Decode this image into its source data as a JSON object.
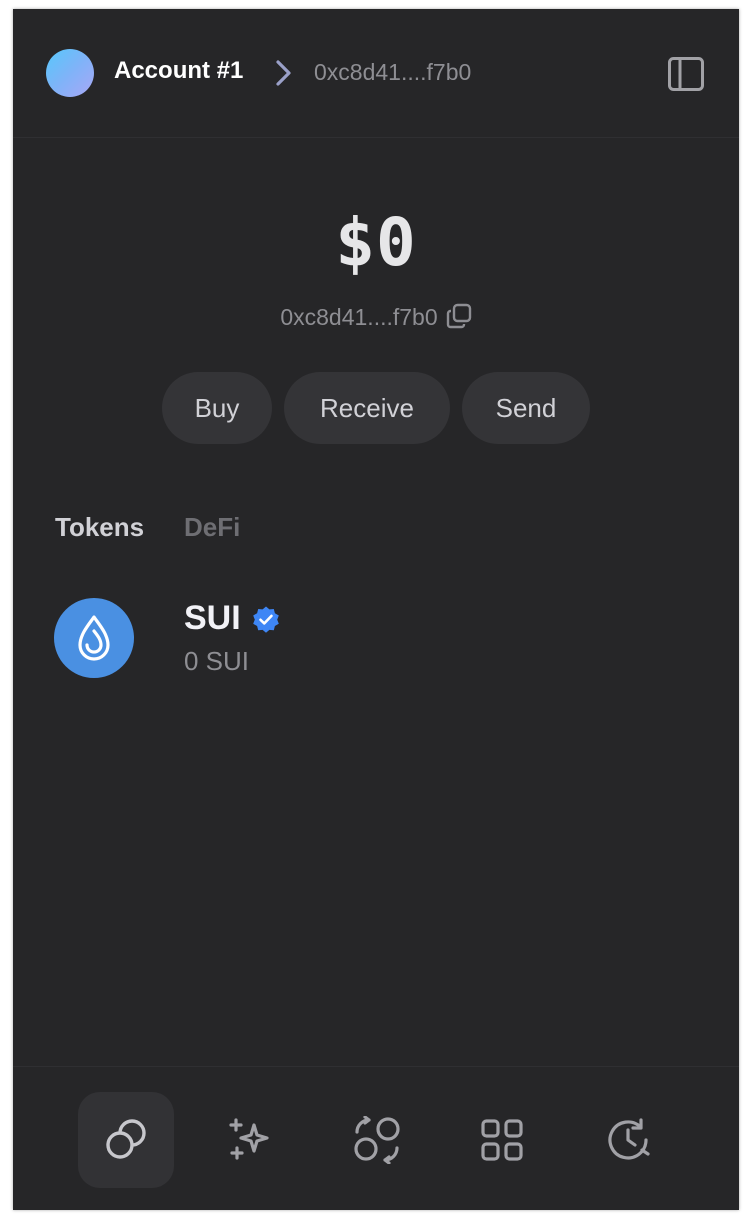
{
  "header": {
    "account_name": "Account #1",
    "address": "0xc8d41....f7b0",
    "avatar_colors": [
      "#57c8fb",
      "#a9a7f6"
    ]
  },
  "balance": {
    "value": "$0",
    "address": "0xc8d41....f7b0"
  },
  "actions": [
    {
      "label": "Buy"
    },
    {
      "label": "Receive"
    },
    {
      "label": "Send"
    }
  ],
  "tabs": [
    {
      "label": "Tokens",
      "active": true
    },
    {
      "label": "DeFi",
      "active": false
    }
  ],
  "tokens": [
    {
      "symbol": "SUI",
      "amount": "0 SUI",
      "verified": true,
      "icon": "sui-drop-icon",
      "color": "#4a90e2"
    }
  ],
  "bottom_nav": [
    {
      "icon": "coins-icon",
      "active": true
    },
    {
      "icon": "sparkles-icon",
      "active": false
    },
    {
      "icon": "swap-icon",
      "active": false
    },
    {
      "icon": "apps-grid-icon",
      "active": false
    },
    {
      "icon": "history-icon",
      "active": false
    }
  ],
  "colors": {
    "background": "#262628",
    "button": "#343437",
    "accent": "#4a90e2"
  }
}
